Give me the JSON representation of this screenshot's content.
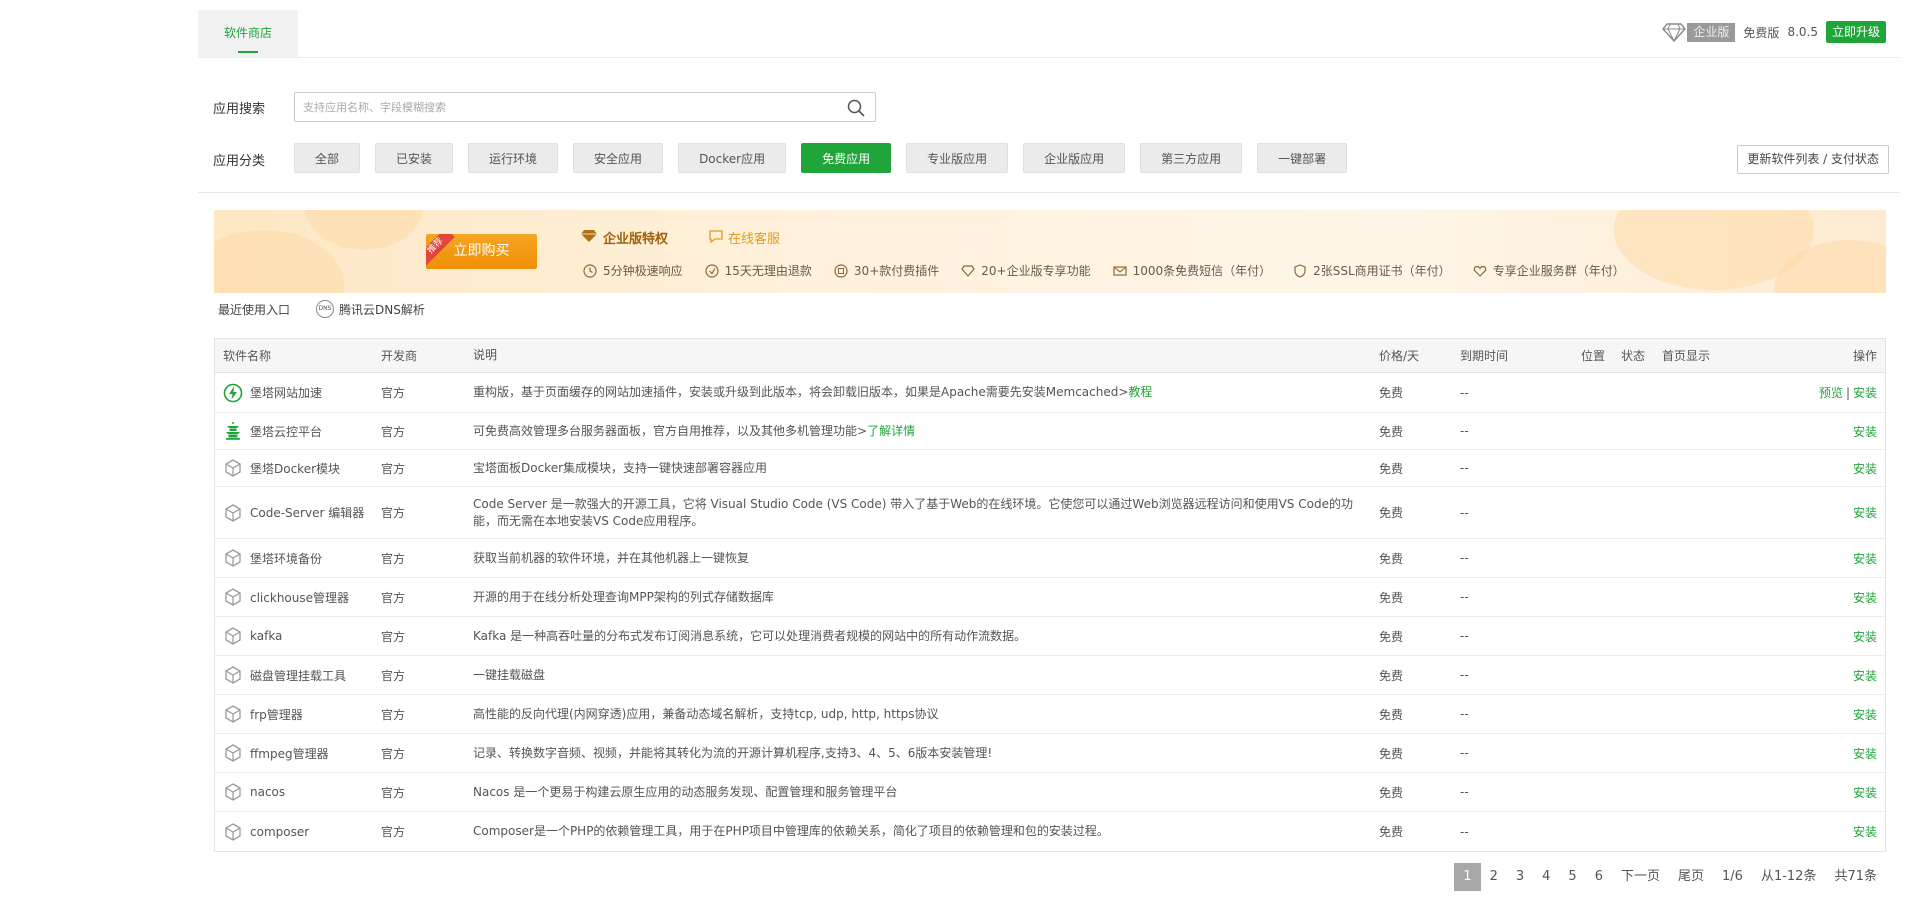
{
  "header": {
    "store_tab": "软件商店",
    "edition_badge": "企业版",
    "free_edition": "免费版",
    "version": "8.0.5",
    "upgrade_label": "立即升级"
  },
  "search": {
    "label": "应用搜索",
    "placeholder": "支持应用名称、字段模糊搜索"
  },
  "categories": {
    "label": "应用分类",
    "items": [
      "全部",
      "已安装",
      "运行环境",
      "安全应用",
      "Docker应用",
      "免费应用",
      "专业版应用",
      "企业版应用",
      "第三方应用",
      "一键部署"
    ],
    "active": "免费应用",
    "refresh_label": "更新软件列表 / 支付状态"
  },
  "banner": {
    "buy_label": "立即购买",
    "recommend_tag": "推荐",
    "privilege_title": "企业版特权",
    "online_service": "在线客服",
    "features": [
      "5分钟极速响应",
      "15天无理由退款",
      "30+款付费插件",
      "20+企业版专享功能",
      "1000条免费短信（年付）",
      "2张SSL商用证书（年付）",
      "专享企业服务群（年付）"
    ]
  },
  "recent": {
    "label": "最近使用入口",
    "dns_icon_text": "DNS",
    "dns_label": "腾讯云DNS解析"
  },
  "table": {
    "headers": {
      "name": "软件名称",
      "dev": "开发商",
      "desc": "说明",
      "price": "价格/天",
      "expire": "到期时间",
      "position": "位置",
      "state": "状态",
      "home": "首页显示",
      "op": "操作"
    },
    "rows": [
      {
        "icon": "bolt-icon",
        "name": "堡塔网站加速",
        "dev": "官方",
        "desc": "重构版，基于页面缓存的网站加速插件，安装或升级到此版本，将会卸载旧版本，如果是Apache需要先安装Memcached>",
        "link": "教程",
        "price": "免费",
        "expire": "--",
        "preview": "预览",
        "action": "安装"
      },
      {
        "icon": "pagoda-icon",
        "name": "堡塔云控平台",
        "dev": "官方",
        "desc": "可免费高效管理多台服务器面板，官方自用推荐，以及其他多机管理功能>",
        "link": "了解详情",
        "price": "免费",
        "expire": "--",
        "preview": "",
        "action": "安装"
      },
      {
        "icon": "cube-icon",
        "name": "堡塔Docker模块",
        "dev": "官方",
        "desc": "宝塔面板Docker集成模块，支持一键快速部署容器应用",
        "link": "",
        "price": "免费",
        "expire": "--",
        "preview": "",
        "action": "安装"
      },
      {
        "icon": "cube-icon",
        "name": "Code-Server 编辑器",
        "dev": "官方",
        "desc": "Code Server 是一款强大的开源工具，它将 Visual Studio Code (VS Code) 带入了基于Web的在线环境。它使您可以通过Web浏览器远程访问和使用VS Code的功能，而无需在本地安装VS Code应用程序。",
        "link": "",
        "price": "免费",
        "expire": "--",
        "preview": "",
        "action": "安装"
      },
      {
        "icon": "cube-icon",
        "name": "堡塔环境备份",
        "dev": "官方",
        "desc": "获取当前机器的软件环境，并在其他机器上一键恢复",
        "link": "",
        "price": "免费",
        "expire": "--",
        "preview": "",
        "action": "安装"
      },
      {
        "icon": "cube-icon",
        "name": "clickhouse管理器",
        "dev": "官方",
        "desc": "开源的用于在线分析处理查询MPP架构的列式存储数据库",
        "link": "",
        "price": "免费",
        "expire": "--",
        "preview": "",
        "action": "安装"
      },
      {
        "icon": "cube-icon",
        "name": "kafka",
        "dev": "官方",
        "desc": "Kafka 是一种高吞吐量的分布式发布订阅消息系统，它可以处理消费者规模的网站中的所有动作流数据。",
        "link": "",
        "price": "免费",
        "expire": "--",
        "preview": "",
        "action": "安装"
      },
      {
        "icon": "cube-icon",
        "name": "磁盘管理挂载工具",
        "dev": "官方",
        "desc": "一键挂载磁盘",
        "link": "",
        "price": "免费",
        "expire": "--",
        "preview": "",
        "action": "安装"
      },
      {
        "icon": "cube-icon",
        "name": "frp管理器",
        "dev": "官方",
        "desc": "高性能的反向代理(内网穿透)应用，兼备动态域名解析，支持tcp, udp, http, https协议",
        "link": "",
        "price": "免费",
        "expire": "--",
        "preview": "",
        "action": "安装"
      },
      {
        "icon": "cube-icon",
        "name": "ffmpeg管理器",
        "dev": "官方",
        "desc": "记录、转换数字音频、视频，并能将其转化为流的开源计算机程序,支持3、4、5、6版本安装管理!",
        "link": "",
        "price": "免费",
        "expire": "--",
        "preview": "",
        "action": "安装"
      },
      {
        "icon": "cube-icon",
        "name": "nacos",
        "dev": "官方",
        "desc": "Nacos 是一个更易于构建云原生应用的动态服务发现、配置管理和服务管理平台",
        "link": "",
        "price": "免费",
        "expire": "--",
        "preview": "",
        "action": "安装"
      },
      {
        "icon": "cube-icon",
        "name": "composer",
        "dev": "官方",
        "desc": "Composer是一个PHP的依赖管理工具，用于在PHP项目中管理库的依赖关系，简化了项目的依赖管理和包的安装过程。",
        "link": "",
        "price": "免费",
        "expire": "--",
        "preview": "",
        "action": "安装"
      }
    ]
  },
  "pager": {
    "pages": [
      "1",
      "2",
      "3",
      "4",
      "5",
      "6"
    ],
    "current": "1",
    "next": "下一页",
    "last": "尾页",
    "page_of": "1/6",
    "range": "从1-12条",
    "total": "共71条"
  },
  "colors": {
    "accent": "#20a53a",
    "banner_gold": "#a0610a"
  }
}
